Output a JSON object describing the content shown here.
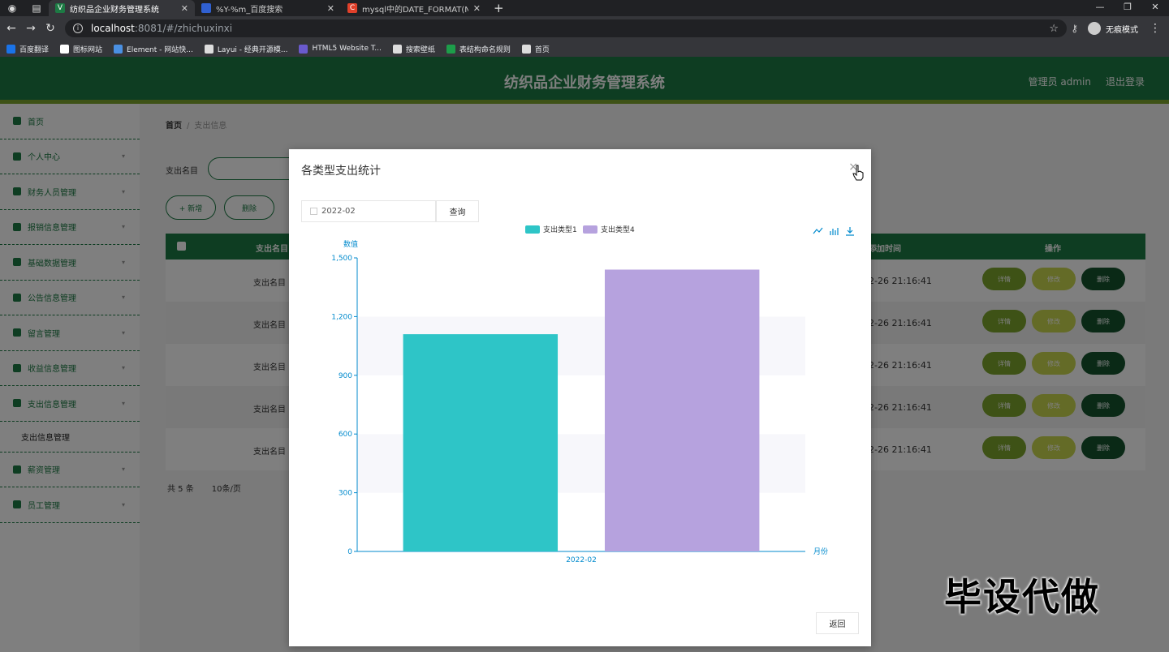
{
  "browser": {
    "tabs": [
      {
        "title": "纺织品企业财务管理系统",
        "favicon_color": "#1d7a44",
        "favicon_glyph": "V",
        "active": true
      },
      {
        "title": "%Y-%m_百度搜索",
        "favicon_color": "#3060d0",
        "favicon_glyph": "",
        "active": false
      },
      {
        "title": "mysql中的DATE_FORMAT(NO",
        "favicon_color": "#e0402a",
        "favicon_glyph": "C",
        "active": false
      }
    ],
    "url_host": "localhost",
    "url_path": ":8081/#/zhichuxinxi",
    "incognito_label": "无痕模式",
    "bookmarks": [
      "百度翻译",
      "图标网站",
      "Element - 网站快...",
      "Layui - 经典开源模...",
      "HTML5 Website T...",
      "搜索壁纸",
      "表结构命名规则",
      "首页"
    ],
    "bookmark_colors": [
      "#1a73e8",
      "#fff",
      "#4a90e2",
      "#ddd",
      "#6a5acd",
      "#ddd",
      "#1d9d4a",
      "#ddd"
    ]
  },
  "app": {
    "title": "纺织品企业财务管理系统",
    "user_label": "管理员 admin",
    "logout_label": "退出登录"
  },
  "sidebar": {
    "items": [
      "首页",
      "个人中心",
      "财务人员管理",
      "报销信息管理",
      "基础数据管理",
      "公告信息管理",
      "留言管理",
      "收益信息管理",
      "支出信息管理"
    ],
    "sub_item": "支出信息管理",
    "items_after": [
      "薪资管理",
      "员工管理"
    ]
  },
  "main": {
    "breadcrumb_home": "首页",
    "breadcrumb_sep": "/",
    "breadcrumb_current": "支出信息",
    "search_label": "支出名目",
    "buttons": [
      "+ 新增",
      "删除"
    ],
    "columns": [
      "支出名目",
      "添加时间",
      "操作"
    ],
    "rows": [
      {
        "name": "支出名目",
        "time": "2-26 21:16:41"
      },
      {
        "name": "支出名目",
        "time": "2-26 21:16:41"
      },
      {
        "name": "支出名目",
        "time": "2-26 21:16:41"
      },
      {
        "name": "支出名目",
        "time": "2-26 21:16:41"
      },
      {
        "name": "支出名目",
        "time": "2-26 21:16:41"
      }
    ],
    "action_labels": {
      "detail": "详情",
      "edit": "修改",
      "delete": "删除"
    },
    "pager_total": "共 5 条",
    "pager_size": "10条/页"
  },
  "modal": {
    "title": "各类型支出统计",
    "close": "×",
    "date_value": "2022-02",
    "query_label": "查询",
    "back_label": "返回"
  },
  "chart_data": {
    "type": "bar",
    "categories": [
      "2022-02"
    ],
    "series": [
      {
        "name": "支出类型1",
        "values": [
          1110
        ],
        "color": "#2ec5c7"
      },
      {
        "name": "支出类型4",
        "values": [
          1440
        ],
        "color": "#b6a2de"
      }
    ],
    "ylabel": "数值",
    "xlabel": "月份",
    "ylim": [
      0,
      1500
    ],
    "yticks": [
      0,
      300,
      600,
      900,
      1200,
      1500
    ],
    "ytick_labels": [
      "0",
      "300",
      "600",
      "900",
      "1,200",
      "1,500"
    ],
    "legend_position": "top-center",
    "grid": "alternating-bands"
  },
  "watermark": "毕设代做"
}
